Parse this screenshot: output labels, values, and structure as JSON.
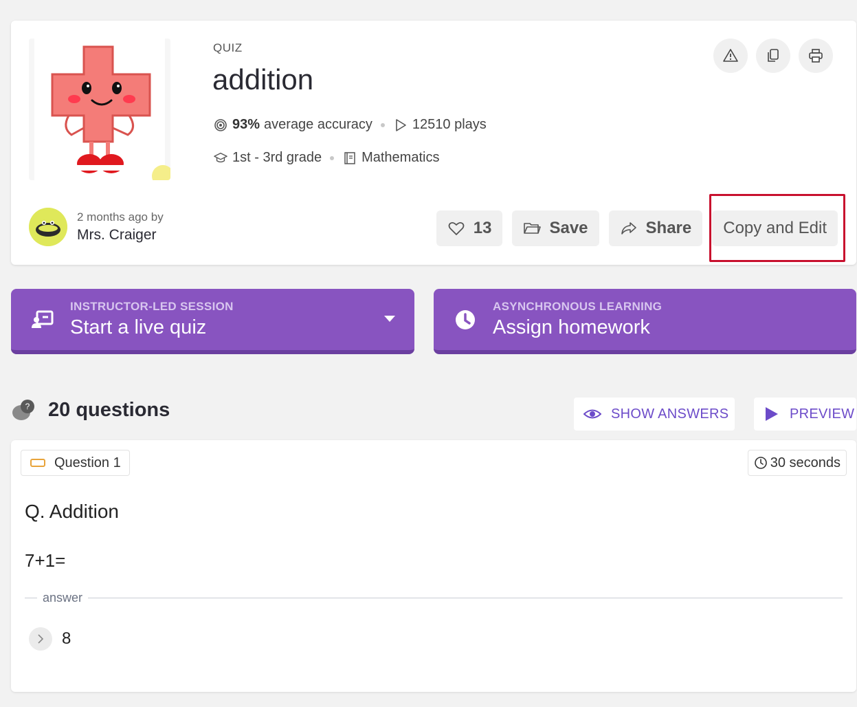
{
  "quiz": {
    "type": "QUIZ",
    "title": "addition",
    "accuracy": "93%",
    "accuracy_label": "average accuracy",
    "plays": "12510 plays",
    "grade": "1st - 3rd grade",
    "subject": "Mathematics"
  },
  "author": {
    "time_ago": "2 months ago by",
    "name": "Mrs. Craiger"
  },
  "actions": {
    "likes": "13",
    "save": "Save",
    "share": "Share",
    "copy_edit": "Copy and Edit"
  },
  "top_icons": [
    "warning-icon",
    "copy-icon",
    "print-icon"
  ],
  "sessions": {
    "live": {
      "sub": "INSTRUCTOR-LED SESSION",
      "main": "Start a live quiz"
    },
    "homework": {
      "sub": "ASYNCHRONOUS LEARNING",
      "main": "Assign homework"
    }
  },
  "questions": {
    "count": "20 questions",
    "show_answers": "SHOW ANSWERS",
    "preview": "PREVIEW"
  },
  "question1": {
    "label": "Question 1",
    "time": "30 seconds",
    "heading": "Q. Addition",
    "text": "7+1=",
    "answer_label": "answer",
    "answer": "8"
  },
  "colors": {
    "purple": "#8854c0",
    "purple_text": "#6c4bc9",
    "highlight": "#c8102e",
    "avatar_bg": "#dfe85a"
  }
}
